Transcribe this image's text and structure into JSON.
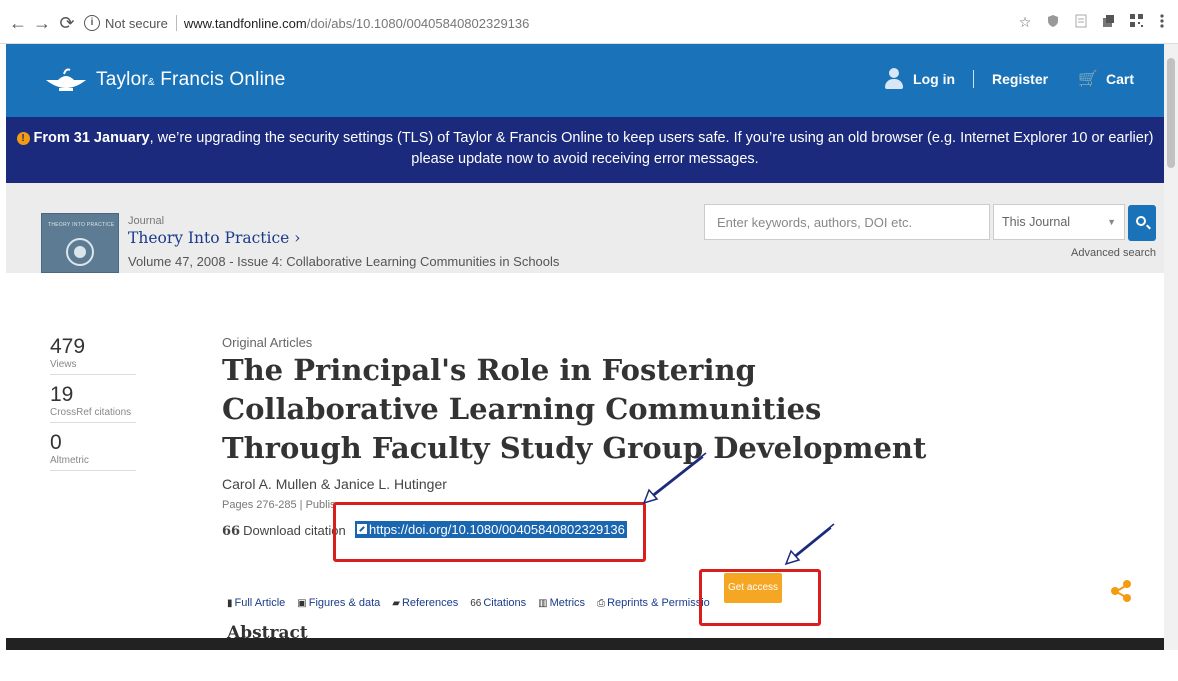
{
  "browser": {
    "back": "←",
    "forward": "→",
    "reload": "⟳",
    "info": "i",
    "not_secure": "Not secure",
    "url_domain": "www.tandfonline.com",
    "url_path": "/doi/abs/10.1080/00405840802329136",
    "star": "☆"
  },
  "header": {
    "logo_main": "Taylor",
    "logo_amp": "&",
    "logo_rest": " Francis Online",
    "login": "Log in",
    "register": "Register",
    "cart": "Cart",
    "cart_glyph": "🛒"
  },
  "alert": {
    "bold": "From 31 January",
    "line1": ", we’re upgrading the security settings (TLS) of Taylor & Francis Online to keep users safe. If you’re using an old browser (e.g. Internet Explorer 10 or earlier)",
    "line2": "please update now to avoid receiving error messages.",
    "icon": "!"
  },
  "journal": {
    "label": "Journal",
    "title": "Theory Into Practice ›",
    "volume": "Volume 47, 2008 - Issue 4: Collaborative Learning Communities in Schools",
    "cover_text": "THEORY INTO PRACTICE"
  },
  "search": {
    "placeholder": "Enter keywords, authors, DOI etc.",
    "scope": "This Journal",
    "advanced": "Advanced search"
  },
  "metrics": [
    {
      "value": "479",
      "label": "Views"
    },
    {
      "value": "19",
      "label": "CrossRef citations"
    },
    {
      "value": "0",
      "label": "Altmetric"
    }
  ],
  "article": {
    "category": "Original Articles",
    "title": "The Principal's Role in Fostering Collaborative Learning Communities Through Faculty Study Group Development",
    "authors": "Carol A. Mullen & Janice L. Hutinger",
    "pages": "Pages 276-285 | Publis",
    "download_citation": "Download citation",
    "quote_glyph": "66",
    "doi": "https://doi.org/10.1080/00405840802329136"
  },
  "tabs": [
    {
      "icon": "▮",
      "label": "Full Article"
    },
    {
      "icon": "▣",
      "label": "Figures & data"
    },
    {
      "icon": "▰",
      "label": "References"
    },
    {
      "icon": "66",
      "label": "Citations"
    },
    {
      "icon": "▥",
      "label": "Metrics"
    },
    {
      "icon": "⎙",
      "label": "Reprints & Permissio"
    }
  ],
  "actions": {
    "get_access": "Get access"
  },
  "abstract_heading": "Abstract",
  "colors": {
    "brand_blue": "#1a73b9",
    "alert_navy": "#1b2a7c",
    "accent_orange": "#f5a623",
    "annotation_red": "#d91e1e"
  }
}
